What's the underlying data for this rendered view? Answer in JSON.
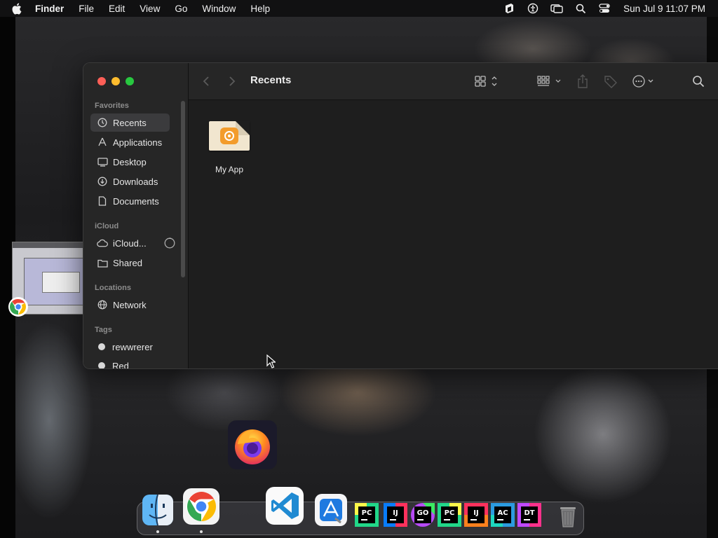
{
  "menubar": {
    "app": "Finder",
    "items": [
      "File",
      "Edit",
      "View",
      "Go",
      "Window",
      "Help"
    ],
    "clock": "Sun Jul 9  11:07 PM",
    "status_icons": [
      "stack-icon",
      "accessibility-icon",
      "screen-mirroring-icon",
      "spotlight-search-icon",
      "control-center-icon"
    ]
  },
  "finder": {
    "title": "Recents",
    "sidebar": {
      "favorites_title": "Favorites",
      "favorites": [
        {
          "label": "Recents",
          "icon": "clock-icon",
          "selected": true
        },
        {
          "label": "Applications",
          "icon": "applications-icon"
        },
        {
          "label": "Desktop",
          "icon": "desktop-icon"
        },
        {
          "label": "Downloads",
          "icon": "download-icon"
        },
        {
          "label": "Documents",
          "icon": "document-icon"
        }
      ],
      "icloud_title": "iCloud",
      "icloud": [
        {
          "label": "iCloud...",
          "icon": "cloud-icon"
        },
        {
          "label": "Shared",
          "icon": "shared-folder-icon"
        }
      ],
      "locations_title": "Locations",
      "locations": [
        {
          "label": "Network",
          "icon": "globe-icon"
        }
      ],
      "tags_title": "Tags",
      "tags": [
        {
          "label": "rewwrerer"
        },
        {
          "label": "Red"
        }
      ]
    },
    "files": [
      {
        "name": "My App",
        "icon": "app-document-icon"
      }
    ]
  },
  "dock": {
    "apps": [
      "Finder",
      "Google Chrome",
      "Visual Studio Code",
      "Xcode",
      "PyCharm",
      "IntelliJ IDEA",
      "GoLand",
      "PyCharm",
      "IntelliJ IDEA",
      "AppCode",
      "dotTrace",
      "Trash"
    ],
    "jetbrains_labels": [
      "PC",
      "IJ",
      "GO",
      "PC",
      "IJ",
      "AC",
      "DT"
    ]
  },
  "colors": {
    "accent_red": "#fe5f57",
    "accent_yellow": "#febc2e",
    "accent_green": "#28c840"
  }
}
